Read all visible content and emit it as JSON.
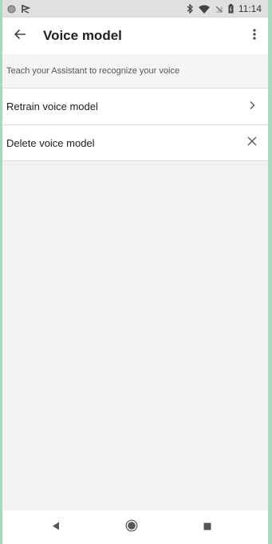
{
  "status_bar": {
    "time": "11:14",
    "icons": [
      "circle-icon",
      "signal-flag-icon",
      "bluetooth-icon",
      "wifi-icon",
      "no-signal-icon",
      "battery-icon"
    ]
  },
  "app_bar": {
    "title": "Voice model",
    "back_icon": "arrow-left-icon",
    "menu_icon": "more-vertical-icon"
  },
  "description": "Teach your Assistant to recognize your voice",
  "items": [
    {
      "label": "Retrain voice model",
      "icon": "chevron-right-icon"
    },
    {
      "label": "Delete voice model",
      "icon": "close-icon"
    }
  ],
  "nav_bar": {
    "icons": [
      "nav-back-icon",
      "nav-home-icon",
      "nav-recent-icon"
    ]
  }
}
